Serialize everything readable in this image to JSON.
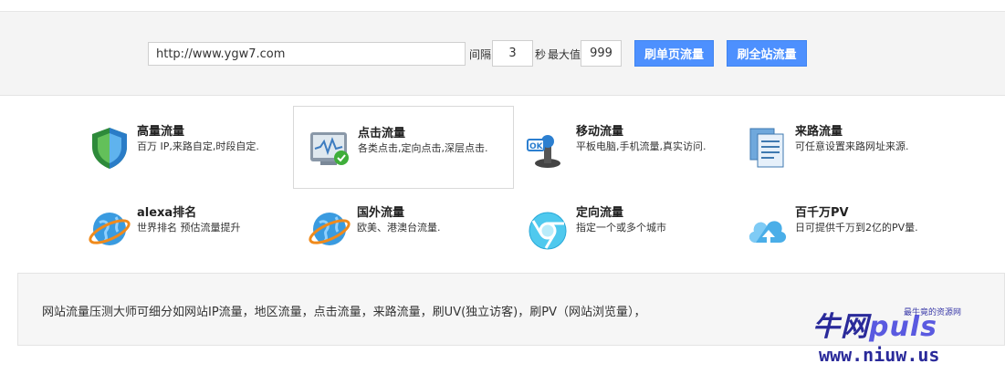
{
  "toolbar": {
    "url_value": "http://www.ygw7.com",
    "interval_label": "间隔",
    "interval_value": "3",
    "seconds_label": "秒",
    "max_label": "最大值",
    "max_value": "999",
    "single_page_button": "刷单页流量",
    "full_site_button": "刷全站流量",
    "button_color": "#4d90fe"
  },
  "features": [
    {
      "title": "高量流量",
      "desc": "百万 IP,来路自定,时段自定.",
      "icon": "shield-icon"
    },
    {
      "title": "点击流量",
      "desc": "各类点击,定向点击,深层点击.",
      "icon": "monitor-check-icon"
    },
    {
      "title": "移动流量",
      "desc": "平板电脑,手机流量,真实访问.",
      "icon": "joystick-icon"
    },
    {
      "title": "来路流量",
      "desc": "可任意设置来路网址来源.",
      "icon": "documents-icon"
    },
    {
      "title": "alexa排名",
      "desc": "世界排名 预估流量提升",
      "icon": "globe-icon"
    },
    {
      "title": "国外流量",
      "desc": "欧美、港澳台流量.",
      "icon": "globe-icon"
    },
    {
      "title": "定向流量",
      "desc": "指定一个或多个城市",
      "icon": "chrome-icon"
    },
    {
      "title": "百千万PV",
      "desc": "日可提供千万到2亿的PV量.",
      "icon": "cloud-upload-icon"
    }
  ],
  "info": {
    "text": "网站流量压测大师可细分如网站IP流量，地区流量，点击流量，来路流量，刷UV(独立访客)，刷PV（网站浏览量），"
  },
  "watermark": {
    "logo_cn": "牛网",
    "logo_en": "puls",
    "tagline": "最牛竟的资源网",
    "url": "www.niuw.us"
  }
}
